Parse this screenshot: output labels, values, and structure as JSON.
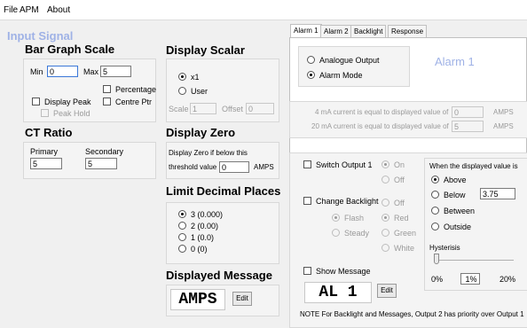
{
  "menu": {
    "file": "File",
    "apm": "APM",
    "about": "About"
  },
  "left": {
    "input_signal": "Input Signal",
    "bar_graph_scale": {
      "title": "Bar Graph Scale",
      "min_label": "Min",
      "min_value": "0",
      "max_label": "Max",
      "max_value": "5",
      "percentage": "Percentage",
      "display_peak": "Display Peak",
      "centre_ptr": "Centre Ptr",
      "peak_hold": "Peak Hold"
    },
    "ct_ratio": {
      "title": "CT Ratio",
      "primary_label": "Primary",
      "primary_value": "5",
      "secondary_label": "Secondary",
      "secondary_value": "5"
    }
  },
  "middle": {
    "display_scalar": {
      "title": "Display Scalar",
      "x1": "x1",
      "user": "User",
      "scale_label": "Scale",
      "scale_value": "1",
      "offset_label": "Offset",
      "offset_value": "0"
    },
    "display_zero": {
      "title": "Display Zero",
      "line1": "Display Zero if below this",
      "threshold_label": "threshold value",
      "threshold_value": "0",
      "unit": "AMPS"
    },
    "limit_decimal": {
      "title": "Limit Decimal Places",
      "options": [
        "3 (0.000)",
        "2 (0.00)",
        "1 (0.0)",
        "0 (0)"
      ]
    },
    "displayed_message": {
      "title": "Displayed Message",
      "value": "AMPS",
      "edit": "Edit"
    }
  },
  "right": {
    "tabs": [
      "Alarm 1",
      "Alarm 2",
      "Backlight",
      "Response"
    ],
    "alarm_title": "Alarm 1",
    "analogue_output": "Analogue Output",
    "alarm_mode": "Alarm Mode",
    "ma4_text": "4 mA current is equal to displayed value of",
    "ma4_value": "0",
    "ma20_text": "20 mA current is equal to displayed value of",
    "ma20_value": "5",
    "amps": "AMPS",
    "switch_output": "Switch Output 1",
    "on": "On",
    "off": "Off",
    "change_backlight": "Change Backlight",
    "bl_off": "Off",
    "red": "Red",
    "green": "Green",
    "white": "White",
    "flash": "Flash",
    "steady": "Steady",
    "when_label": "When the displayed value is",
    "above": "Above",
    "below": "Below",
    "below_value": "3.75",
    "between": "Between",
    "outside": "Outside",
    "hysteresis": "Hysterisis",
    "hyst_min": "0%",
    "hyst_value": "1%",
    "hyst_max": "20%",
    "show_message": "Show Message",
    "message_value": "AL 1",
    "edit": "Edit",
    "note": "NOTE  For Backlight and Messages, Output 2 has priority over Output 1"
  }
}
